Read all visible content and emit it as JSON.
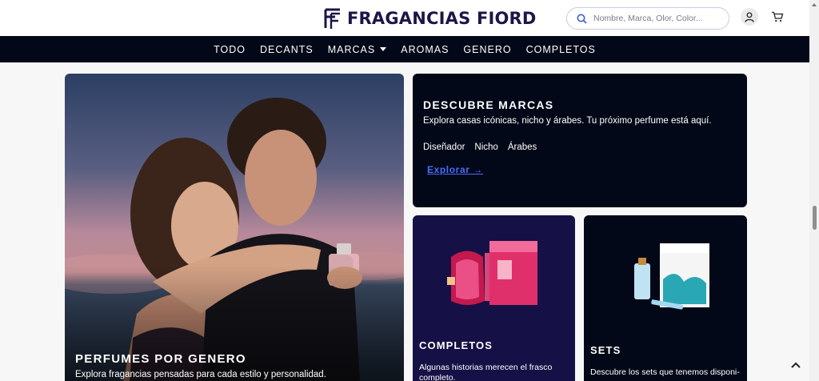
{
  "header": {
    "brand": "FRAGANCIAS FIORD",
    "search_placeholder": "Nombre, Marca, Olor, Color...",
    "icons": {
      "logo": "ff-monogram-icon",
      "search": "search-icon",
      "user": "user-icon",
      "cart": "cart-icon"
    }
  },
  "nav": {
    "items": [
      "TODO",
      "DECANTS",
      "MARCAS",
      "AROMAS",
      "GENERO",
      "COMPLETOS"
    ]
  },
  "hero": {
    "title": "PERFUMES POR GENERO",
    "subtitle": "Explora fragancias pensadas para cada estilo y personalidad."
  },
  "marcas_card": {
    "title": "DESCUBRE MARCAS",
    "subtitle": "Explora casas icónicas, nicho y árabes. Tu próximo perfume está aquí.",
    "links": [
      "Diseñador",
      "Nicho",
      "Árabes"
    ],
    "cta": "Explorar →"
  },
  "completos_card": {
    "title": "COMPLETOS",
    "subtitle": "Algunas historias merecen el frasco completo."
  },
  "sets_card": {
    "title": "SETS",
    "subtitle": "Descubre los sets que tenemos disponi-"
  },
  "colors": {
    "nav_bg": "#020817",
    "brand": "#1a1747",
    "link": "#4a6cff",
    "completos_bg": "#151045"
  }
}
